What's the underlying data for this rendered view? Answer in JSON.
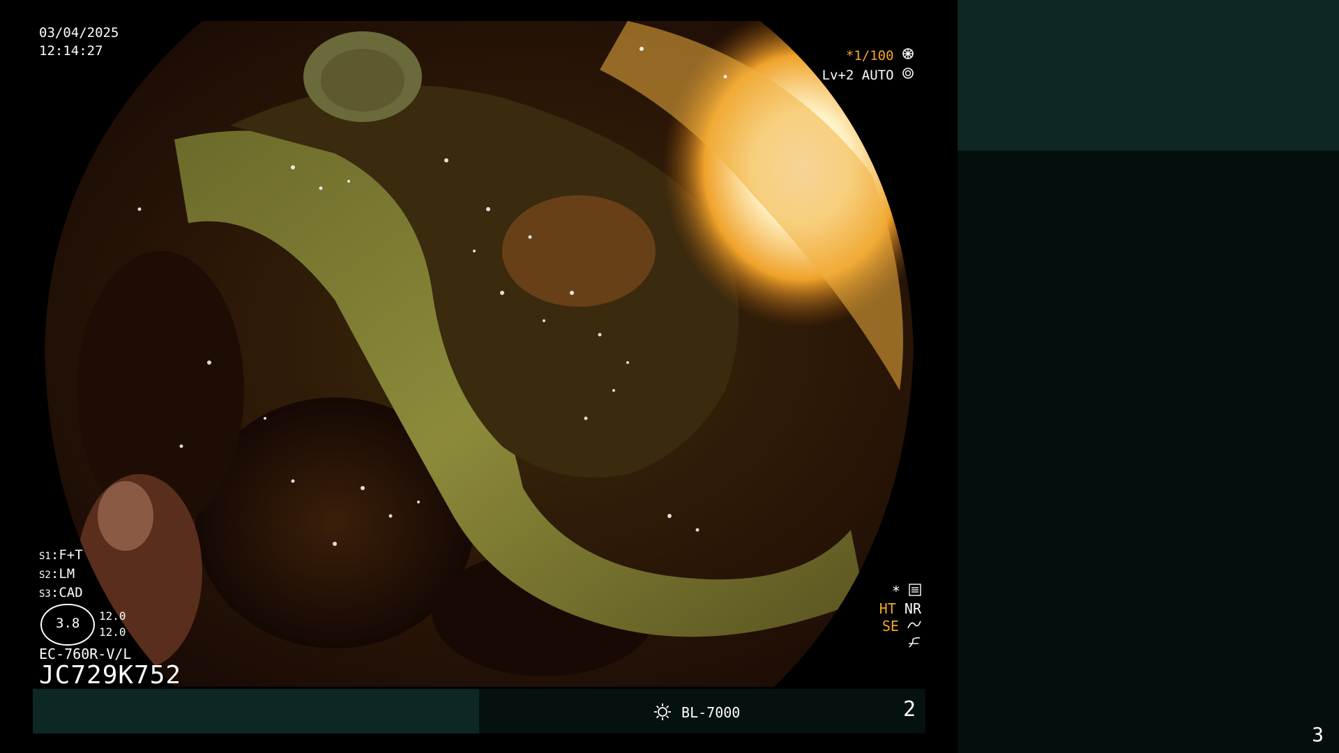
{
  "overlay": {
    "date": "03/04/2025",
    "time": "12:14:27",
    "shutter": "*1/100",
    "iris_level": "Lv+2",
    "iris_mode": "AUTO",
    "switches": [
      {
        "key": "S1",
        "value": "F+T"
      },
      {
        "key": "S2",
        "value": "LM"
      },
      {
        "key": "S3",
        "value": "CAD"
      }
    ],
    "gauge_value": "3.8",
    "gauge_right_top": "12.0",
    "gauge_right_bottom": "12.0",
    "scope_model": "EC-760R-V/L",
    "scope_serial": "JC729K752",
    "proc_star": "*",
    "proc_ht": "HT",
    "proc_nr": "NR",
    "proc_se": "SE"
  },
  "bottom_bar": {
    "light_source": "BL-7000",
    "page_number": "2"
  },
  "right_panel": {
    "page_number": "3"
  },
  "colors": {
    "overlay_text": "#ffffff",
    "overlay_accent": "#f5a623",
    "panel_dark": "#040f0d",
    "panel_teal": "#0e2624"
  },
  "icons": [
    "settings-dial-icon",
    "iris-icon",
    "menu-icon",
    "enhance-curve-icon",
    "sun-icon"
  ]
}
